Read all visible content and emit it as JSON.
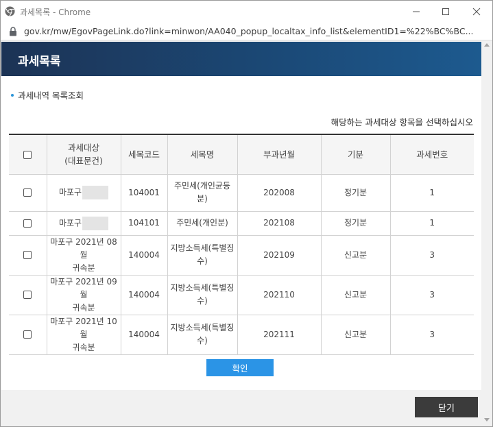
{
  "window": {
    "title": "과세목록 - Chrome",
    "url": "gov.kr/mw/EgovPageLink.do?link=minwon/AA040_popup_localtax_info_list&elementID1=%22%BC%BC..."
  },
  "header": {
    "title": "과세목록"
  },
  "section": {
    "title": "과세내역 목록조회",
    "instruction": "해당하는 과세대상 항목을 선택하십시오"
  },
  "table": {
    "headers": {
      "target_line1": "과세대상",
      "target_line2": "(대표문건)",
      "tax_code": "세목코드",
      "tax_name": "세목명",
      "levy_month": "부과년월",
      "period_type": "기분",
      "tax_no": "과세번호"
    },
    "rows": [
      {
        "target_line1": "마포구",
        "target_line2": "",
        "tax_code": "104001",
        "tax_name_line1": "주민세(개인균등",
        "tax_name_line2": "분)",
        "levy_month": "202008",
        "period_type": "정기분",
        "tax_no": "1"
      },
      {
        "target_line1": "마포구",
        "target_line2": "",
        "tax_code": "104101",
        "tax_name_line1": "주민세(개인분)",
        "tax_name_line2": "",
        "levy_month": "202108",
        "period_type": "정기분",
        "tax_no": "1"
      },
      {
        "target_line1": "마포구 2021년 08월",
        "target_line2": "귀속분",
        "tax_code": "140004",
        "tax_name_line1": "지방소득세(특별징",
        "tax_name_line2": "수)",
        "levy_month": "202109",
        "period_type": "신고분",
        "tax_no": "3"
      },
      {
        "target_line1": "마포구 2021년 09월",
        "target_line2": "귀속분",
        "tax_code": "140004",
        "tax_name_line1": "지방소득세(특별징",
        "tax_name_line2": "수)",
        "levy_month": "202110",
        "period_type": "신고분",
        "tax_no": "3"
      },
      {
        "target_line1": "마포구 2021년 10월",
        "target_line2": "귀속분",
        "tax_code": "140004",
        "tax_name_line1": "지방소득세(특별징",
        "tax_name_line2": "수)",
        "levy_month": "202111",
        "period_type": "신고분",
        "tax_no": "3"
      }
    ]
  },
  "buttons": {
    "confirm": "확인",
    "close": "닫기"
  },
  "colors": {
    "header_bg": "#1b4a78",
    "confirm_btn": "#2b94e6",
    "close_btn": "#3b3b3b"
  }
}
